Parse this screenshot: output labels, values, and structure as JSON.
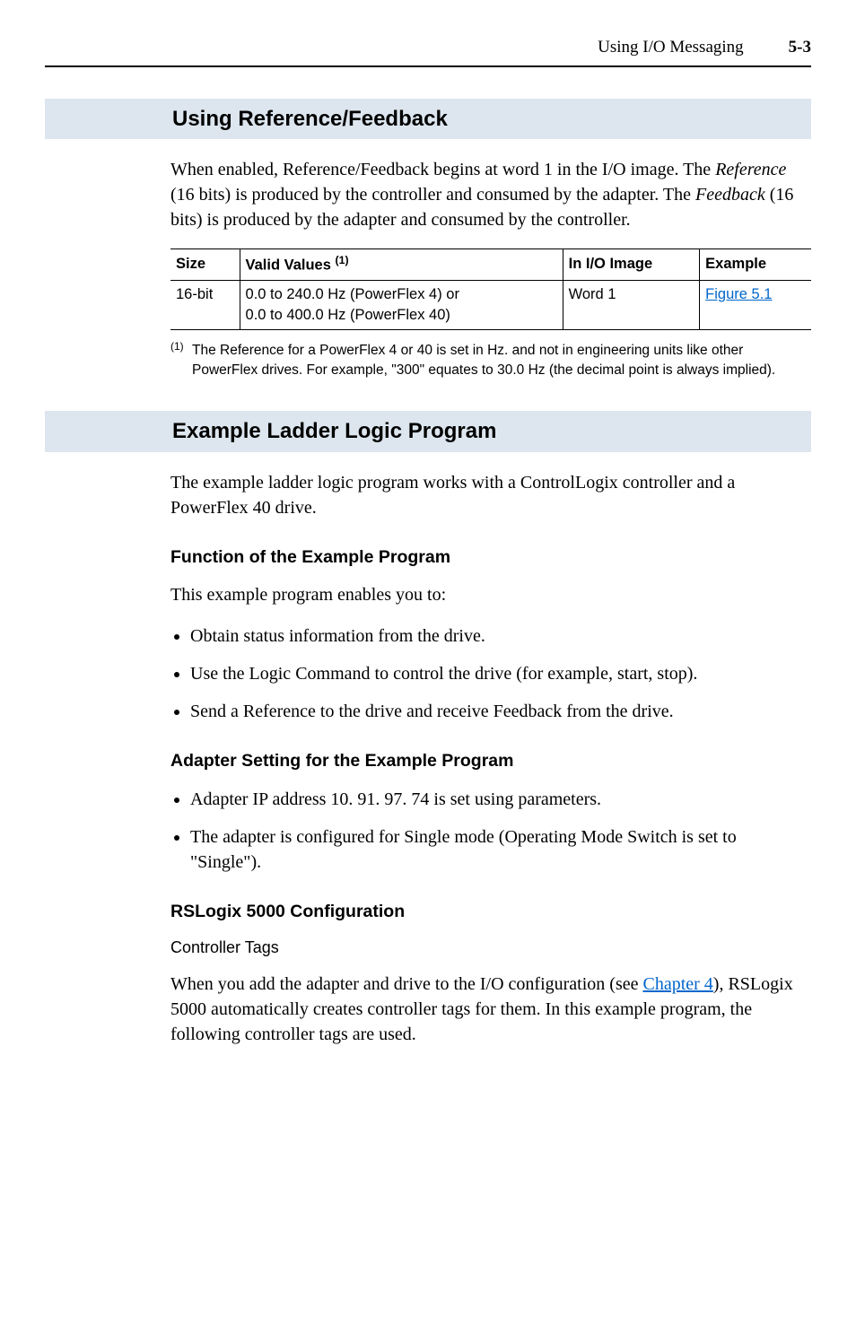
{
  "header": {
    "title": "Using I/O Messaging",
    "page": "5-3"
  },
  "section1": {
    "title": "Using Reference/Feedback",
    "para_pre": "When enabled, Reference/Feedback begins at word 1 in the I/O image. The ",
    "ref_word": "Reference",
    "para_mid1": " (16 bits) is produced by the controller and consumed by the adapter. The ",
    "fb_word": "Feedback",
    "para_mid2": " (16 bits) is produced by the adapter and consumed by the controller.",
    "table": {
      "headers": {
        "size": "Size",
        "valid": "Valid Values",
        "valid_sup": "(1)",
        "io": "In I/O Image",
        "example": "Example"
      },
      "row": {
        "size": "16-bit",
        "valid_line1": "0.0 to 240.0 Hz (PowerFlex 4) or",
        "valid_line2": "0.0 to 400.0 Hz (PowerFlex 40)",
        "io": "Word 1",
        "example": "Figure 5.1"
      }
    },
    "footnote": {
      "num": "(1)",
      "text": "The Reference for a PowerFlex 4 or 40 is set in Hz. and not in engineering units like other PowerFlex drives. For example, \"300\" equates to 30.0 Hz (the decimal point is always implied)."
    }
  },
  "section2": {
    "title": "Example Ladder Logic Program",
    "para": "The example ladder logic program works with a ControlLogix controller and a PowerFlex 40 drive.",
    "sub1": {
      "title": "Function of the Example Program",
      "intro": "This example program enables you to:",
      "bullets": [
        "Obtain status information from the drive.",
        "Use the Logic Command to control the drive (for example, start, stop).",
        "Send a Reference to the drive and receive Feedback from the drive."
      ]
    },
    "sub2": {
      "title": "Adapter Setting for the Example Program",
      "bullets": [
        "Adapter IP address 10. 91. 97. 74 is set using parameters.",
        "The adapter is configured for Single mode (Operating Mode Switch is set to \"Single\")."
      ]
    },
    "sub3": {
      "title": "RSLogix 5000 Configuration",
      "subsub": "Controller Tags",
      "para_pre": "When you add the adapter and drive to the I/O configuration (see ",
      "link": "Chapter 4",
      "para_post": "), RSLogix 5000 automatically creates controller tags for them. In this example program, the following controller tags are used."
    }
  }
}
